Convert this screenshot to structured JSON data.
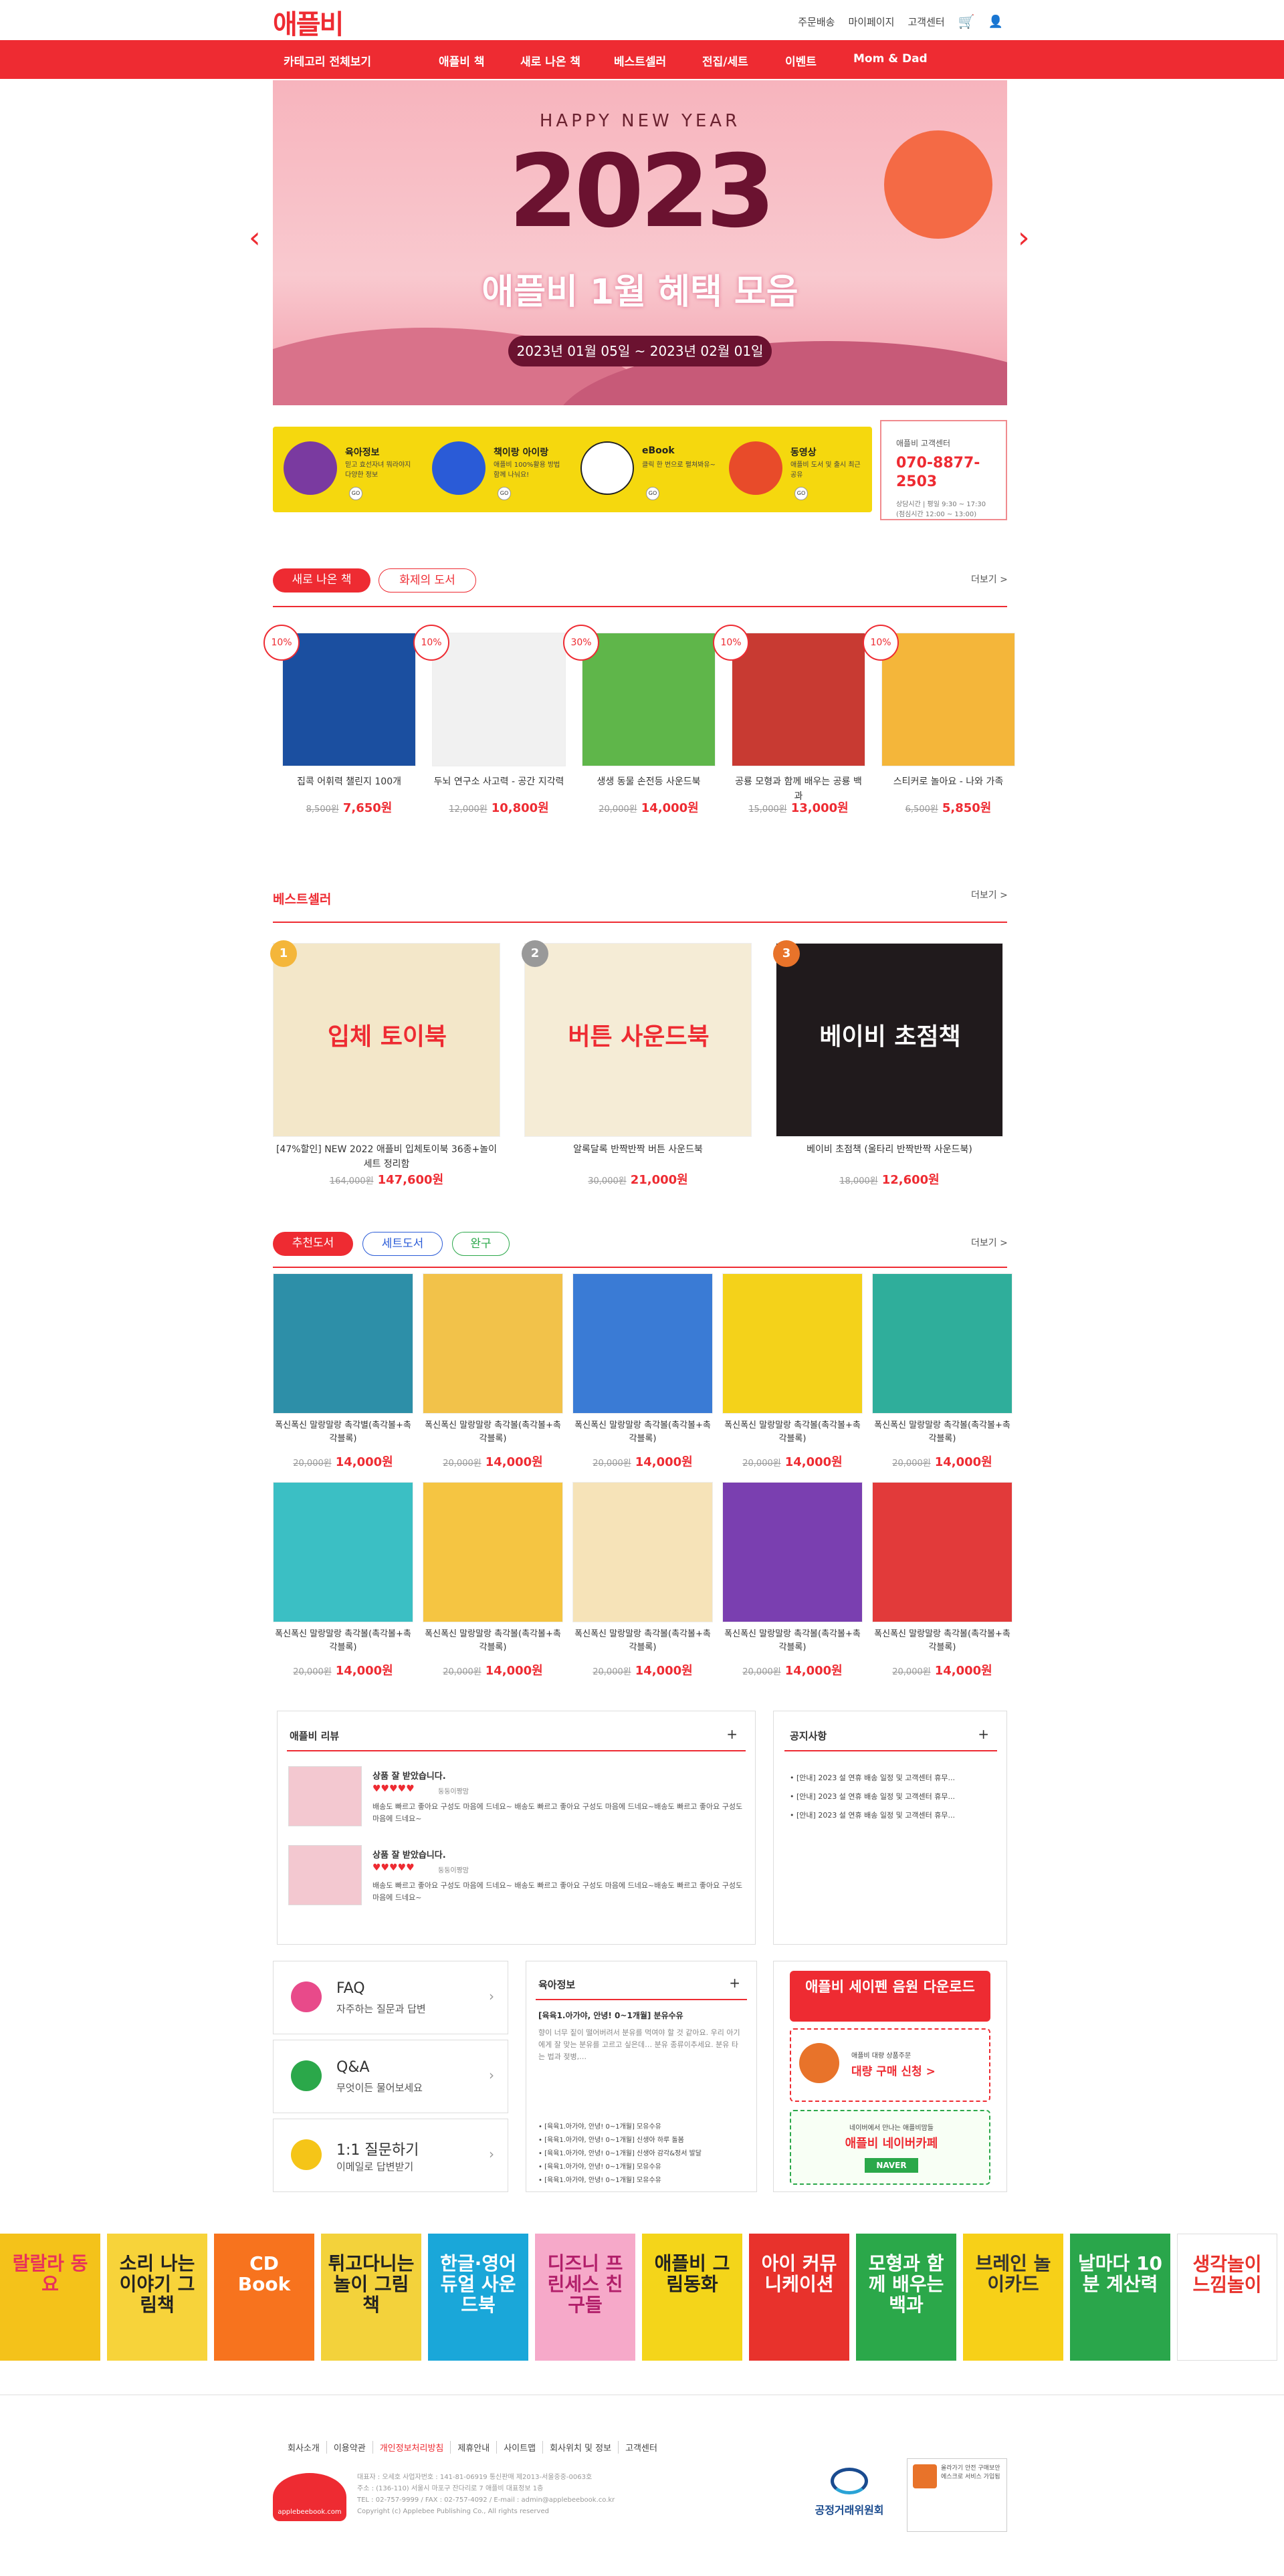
{
  "header": {
    "logo": "애플비",
    "top_links": [
      "주문배송",
      "마이페이지",
      "고객센터"
    ]
  },
  "gnb": {
    "items": [
      "카테고리 전체보기",
      "애플비 책",
      "새로 나온 책",
      "베스트셀러",
      "전집/세트",
      "이벤트",
      "Mom & Dad"
    ]
  },
  "hero": {
    "greeting": "HAPPY NEW YEAR",
    "year": "2023",
    "headline": "애플비 1월 혜택 모음",
    "period": "2023년 01월 05일 ~ 2023년 02월 01일"
  },
  "quick_menu": [
    {
      "title": "육아정보",
      "desc": "믿고 효선자녀 뭐라야지 다양한 정보",
      "color": "#7a3aa0"
    },
    {
      "title": "책이랑 아이랑",
      "desc": "애플비 100%활용 방법 함께 나눠요!",
      "color": "#2a5bd7"
    },
    {
      "title": "eBook",
      "desc": "클릭 한 번으로 펼쳐봐유~",
      "color": "#ffffff"
    },
    {
      "title": "동영상",
      "desc": "애플비 도서 및 출시 최근 공유",
      "color": "#e84b2a"
    }
  ],
  "customer_center": {
    "label": "애플비 고객센터",
    "phone": "070-8877-2503",
    "hours": "상담시간 | 평일 9:30 ~ 17:30",
    "lunch": "(점심시간 12:00 ~ 13:00)"
  },
  "new_books": {
    "tabs": [
      "새로 나온 책",
      "화제의 도서"
    ],
    "more": "더보기 >",
    "items": [
      {
        "discount": "10%",
        "name": "집콕 어휘력 챌린지 100개",
        "old": "8,500원",
        "price": "7,650원",
        "color": "#1b4fa0"
      },
      {
        "discount": "10%",
        "name": "두뇌 연구소 사고력 - 공간 지각력",
        "old": "12,000원",
        "price": "10,800원",
        "color": "#f1f1f1"
      },
      {
        "discount": "30%",
        "name": "생생 동물 손전등 사운드북",
        "old": "20,000원",
        "price": "14,000원",
        "color": "#5fb64a"
      },
      {
        "discount": "10%",
        "name": "공룡 모형과 함께 배우는 공룡 백과",
        "old": "15,000원",
        "price": "13,000원",
        "color": "#c83a32"
      },
      {
        "discount": "10%",
        "name": "스티커로 놀아요 - 나와 가족",
        "old": "6,500원",
        "price": "5,850원",
        "color": "#f4b63a"
      }
    ]
  },
  "bestseller": {
    "title": "베스트셀러",
    "more": "더보기 >",
    "items": [
      {
        "rank": "1",
        "name": "[47%할인] NEW 2022 애플비 입체토이북 36종+놀이세트 정리함",
        "old": "164,000원",
        "price": "147,600원",
        "cover": "입체 토이북"
      },
      {
        "rank": "2",
        "name": "알록달록 반짝반짝 버튼 사운드북",
        "old": "30,000원",
        "price": "21,000원",
        "cover": "버튼 사운드북"
      },
      {
        "rank": "3",
        "name": "베이비 초점책 (울타리 반짝반짝 사운드북)",
        "old": "18,000원",
        "price": "12,600원",
        "cover": "베이비 초점책"
      }
    ]
  },
  "recommend": {
    "tabs": [
      "추천도서",
      "세트도서",
      "완구"
    ],
    "more": "더보기 >",
    "items": [
      {
        "name": "폭신폭신 말랑말랑 촉각별(촉각볼+촉각블록)",
        "old": "20,000원",
        "price": "14,000원",
        "color": "#2d8fa8"
      },
      {
        "name": "폭신폭신 말랑말랑 촉각볼(촉각볼+촉각블록)",
        "old": "20,000원",
        "price": "14,000원",
        "color": "#f2c24a"
      },
      {
        "name": "폭신폭신 말랑말랑 촉각볼(촉각볼+촉각블록)",
        "old": "20,000원",
        "price": "14,000원",
        "color": "#3a7bd5"
      },
      {
        "name": "폭신폭신 말랑말랑 촉각볼(촉각볼+촉각블록)",
        "old": "20,000원",
        "price": "14,000원",
        "color": "#f4d21a"
      },
      {
        "name": "폭신폭신 말랑말랑 촉각볼(촉각볼+촉각블록)",
        "old": "20,000원",
        "price": "14,000원",
        "color": "#2fae9b"
      },
      {
        "name": "폭신폭신 말랑말랑 촉각볼(촉각볼+촉각블록)",
        "old": "20,000원",
        "price": "14,000원",
        "color": "#3bbfc4"
      },
      {
        "name": "폭신폭신 말랑말랑 촉각볼(촉각볼+촉각블록)",
        "old": "20,000원",
        "price": "14,000원",
        "color": "#f5c542"
      },
      {
        "name": "폭신폭신 말랑말랑 촉각볼(촉각볼+촉각블록)",
        "old": "20,000원",
        "price": "14,000원",
        "color": "#f6e3b8"
      },
      {
        "name": "폭신폭신 말랑말랑 촉각볼(촉각볼+촉각블록)",
        "old": "20,000원",
        "price": "14,000원",
        "color": "#7a3fb0"
      },
      {
        "name": "폭신폭신 말랑말랑 촉각볼(촉각볼+촉각블록)",
        "old": "20,000원",
        "price": "14,000원",
        "color": "#e23a3a"
      }
    ]
  },
  "reviews": {
    "title": "애플비 리뷰",
    "items": [
      {
        "title": "상품 잘 받았습니다.",
        "stars": "♥♥♥♥♥",
        "user": "둥둥이짱맘",
        "text": "배송도 빠르고 좋아요 구성도 마음에 드네요~ 배송도 빠르고 좋아요 구성도 마음에 드네요~배송도 빠르고 좋아요 구성도 마음에 드네요~"
      },
      {
        "title": "상품 잘 받았습니다.",
        "stars": "♥♥♥♥♥",
        "user": "둥둥이짱맘",
        "text": "배송도 빠르고 좋아요 구성도 마음에 드네요~ 배송도 빠르고 좋아요 구성도 마음에 드네요~배송도 빠르고 좋아요 구성도 마음에 드네요~"
      }
    ]
  },
  "notice": {
    "title": "공지사항",
    "items": [
      "[안내] 2023 설 연휴 배송 일정 및 고객센터 휴무...",
      "[안내] 2023 설 연휴 배송 일정 및 고객센터 휴무...",
      "[안내] 2023 설 연휴 배송 일정 및 고객센터 휴무..."
    ]
  },
  "help": [
    {
      "title": "FAQ",
      "desc": "자주하는 질문과 답변"
    },
    {
      "title": "Q&A",
      "desc": "무엇이든 물어보세요"
    },
    {
      "title": "1:1 질문하기",
      "desc": "이메일로 답변받기"
    }
  ],
  "parenting": {
    "title": "육아정보",
    "headline": "[육육1.아가야, 안녕! 0~1개월] 분유수유",
    "summary": "향이 너무 짙이 떨어버려서 분유를 먹여야 할 것 같아요. 우리 아기에게 잘 맞는 분유를 고르고 싶은데… 분유 종류이추세요. 분유 타는 법과 젖병,…",
    "list": [
      "[육육1.아가야, 안녕! 0~1개월] 모유수유",
      "[육육1.아가야, 안녕! 0~1개월] 신생아 하루 돌봄",
      "[육육1.아가야, 안녕! 0~1개월] 신생아 감각&정서 발달",
      "[육육1.아가야, 안녕! 0~1개월] 모유수유",
      "[육육1.아가야, 안녕! 0~1개월] 모유수유"
    ]
  },
  "app_banner": {
    "title": "애플비 세이펜 음원 다운로드",
    "bulk_small": "애플비 대량 상품주문",
    "bulk": "대량 구매 신청 >",
    "cafe_small": "네이버에서 만나는 애플비맘들",
    "cafe": "애플비 네이버카페",
    "naver": "NAVER"
  },
  "book_strip": [
    {
      "text": "랄랄라 동요",
      "bg": "#f4c21a",
      "fg": "#e8325a"
    },
    {
      "text": "소리 나는 이야기 그림책",
      "bg": "#f7d33a",
      "fg": "#222"
    },
    {
      "text": "CD Book",
      "bg": "#f7731e",
      "fg": "#fff"
    },
    {
      "text": "튀고다니는 놀이 그림책",
      "bg": "#f3d23b",
      "fg": "#222"
    },
    {
      "text": "한글·영어 듀얼 사운드북",
      "bg": "#1aa7d9",
      "fg": "#fff"
    },
    {
      "text": "디즈니 프린세스 친구들",
      "bg": "#f6a9c9",
      "fg": "#b21f6a"
    },
    {
      "text": "애플비 그림동화",
      "bg": "#f4d51a",
      "fg": "#222"
    },
    {
      "text": "아이 커뮤니케이션",
      "bg": "#e8322c",
      "fg": "#fff"
    },
    {
      "text": "모형과 함께 배우는 백과",
      "bg": "#2ba84a",
      "fg": "#fff"
    },
    {
      "text": "브레인 놀이카드",
      "bg": "#f7d018",
      "fg": "#333"
    },
    {
      "text": "날마다 10분 계산력",
      "bg": "#2aa64b",
      "fg": "#fff"
    },
    {
      "text": "생각놀이 느낌놀이",
      "bg": "#ffffff",
      "fg": "#e8322c"
    }
  ],
  "footer": {
    "links": [
      "회사소개",
      "이용약관",
      "개인정보처리방침",
      "제휴안내",
      "사이트맵",
      "회사위치 및 정보",
      "고객센터"
    ],
    "company": "대표자 : 오세호 사업자번호 : 141-81-06919 통신판매 제2013-서울중중-0063호",
    "address": "주소 : (136-110) 서울시 마포구 잔다리로 7 애플비 대표정보 1층",
    "contact": "TEL : 02-757-9999 / FAX : 02-757-4092 / E-mail : admin@applebeebook.co.kr",
    "copyright": "Copyright (c) Applebee Publishing Co., All rights reserved",
    "brand_url": "applebeebook.com",
    "ftc": "공정거래위원회",
    "consumer": "올라가기 안전 구매보안 에스크로 서비스 가입됨"
  },
  "colors": {
    "brand": "#ee2b32",
    "yellow": "#f5d80e"
  }
}
